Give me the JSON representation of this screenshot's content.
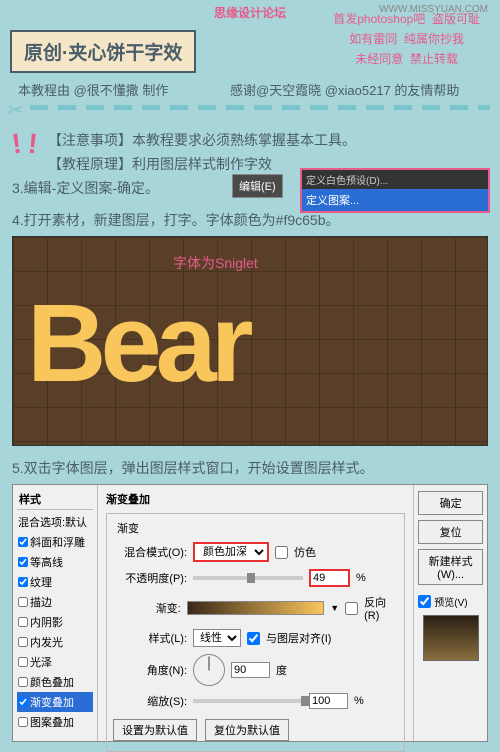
{
  "watermark": "WWW.MISSYUAN.COM",
  "forum_text": "思缘设计论坛",
  "title": "原创·夹心饼干字效",
  "warnings": {
    "l1a": "首发photoshop吧",
    "l1b": "盗版可耻",
    "l2a": "如有雷同",
    "l2b": "纯属你抄我",
    "l3a": "未经同意",
    "l3b": "禁止转载"
  },
  "author": "本教程由 @很不懂撒 制作",
  "thanks": "感谢@天空霞晓 @xiao5217 的友情帮助",
  "note1": "【注意事项】本教程要求必须熟练掌握基本工具。",
  "note2": "【教程原理】利用图层样式制作字效",
  "step3": "3.编辑-定义图案-确定。",
  "edit_btn": "编辑(E)",
  "menu_row1": "定义白色预设(D)...",
  "menu_row2": "定义图案...",
  "step4": "4.打开素材，新建图层，打字。字体颜色为#f9c65b。",
  "bear": "Bear",
  "font_label": "字体为Sniglet",
  "step5": "5.双击字体图层，弹出图层样式窗口，开始设置图层样式。",
  "dialog": {
    "styles_hdr": "样式",
    "blend_default": "混合选项:默认",
    "items": [
      "斜面和浮雕",
      "等高线",
      "纹理",
      "描边",
      "内阴影",
      "内发光",
      "光泽",
      "颜色叠加",
      "渐变叠加",
      "图案叠加"
    ],
    "checked": [
      true,
      true,
      true,
      false,
      false,
      false,
      false,
      false,
      true,
      false
    ],
    "selected_idx": 8,
    "section": "渐变叠加",
    "subsection": "渐变",
    "blend_mode_lbl": "混合模式(O):",
    "blend_mode_val": "颜色加深",
    "dither": "仿色",
    "opacity_lbl": "不透明度(P):",
    "opacity_val": "49",
    "pct": "%",
    "grad_lbl": "渐变:",
    "reverse": "反向(R)",
    "style_lbl": "样式(L):",
    "style_val": "线性",
    "align": "与图层对齐(I)",
    "angle_lbl": "角度(N):",
    "angle_val": "90",
    "degree": "度",
    "scale_lbl": "缩放(S):",
    "scale_val": "100",
    "btn_default": "设置为默认值",
    "btn_reset": "复位为默认值",
    "ok": "确定",
    "cancel": "复位",
    "new_style": "新建样式(W)...",
    "preview_chk": "预览(V)"
  }
}
